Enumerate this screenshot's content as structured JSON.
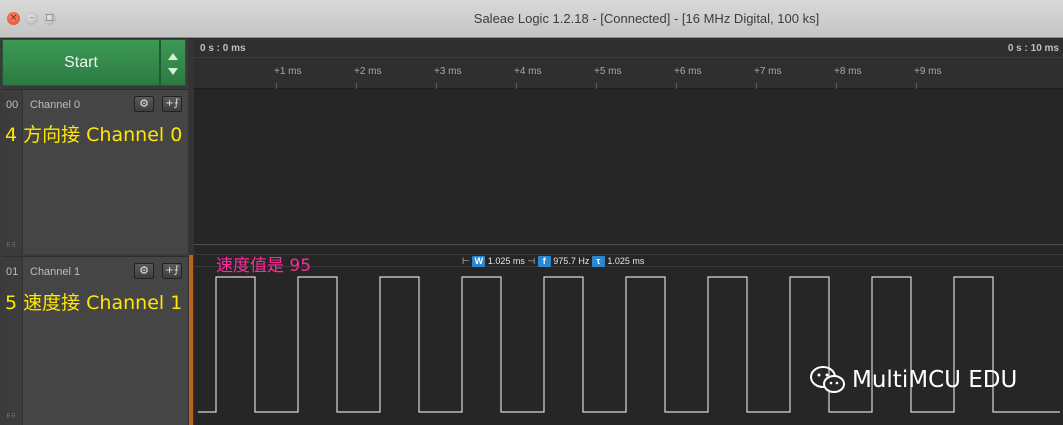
{
  "window": {
    "title": "Saleae Logic 1.2.18 - [Connected] - [16 MHz Digital, 100 ks]",
    "close_glyph": "×",
    "minimize_glyph": "–",
    "maximize_glyph": "□"
  },
  "toolbar": {
    "start_label": "Start"
  },
  "timeline": {
    "start_label": "0 s : 0 ms",
    "end_label": "0 s : 10 ms",
    "ticks": [
      "+1 ms",
      "+2 ms",
      "+3 ms",
      "+4 ms",
      "+5 ms",
      "+6 ms",
      "+7 ms",
      "+8 ms",
      "+9 ms"
    ]
  },
  "channels": [
    {
      "number": "00",
      "name": "Channel 0",
      "annotation": "4 方向接 Channel 0",
      "signal": "idle"
    },
    {
      "number": "01",
      "name": "Channel 1",
      "annotation": "5 速度接 Channel 1",
      "signal": "pwm",
      "period_ms": 1.025,
      "duty": 0.48,
      "pulses_visible": 10
    }
  ],
  "speed_annotation": "速度值是 95",
  "measurements": {
    "width_icon": "W",
    "width_value": "1.025 ms",
    "freq_icon": "f",
    "freq_value": "975.7 Hz",
    "period_icon": "τ",
    "period_value": "1.025 ms"
  },
  "watermark": {
    "text": "MultiMCU EDU",
    "icon": "wechat-icon"
  },
  "colors": {
    "start_green": "#2c7a42",
    "annotation_yellow": "#ffe700",
    "annotation_pink": "#ff2a9e",
    "measure_blue": "#2a87d0",
    "trigger_orange": "#b8661f",
    "waveform": "#d8d8d8"
  }
}
